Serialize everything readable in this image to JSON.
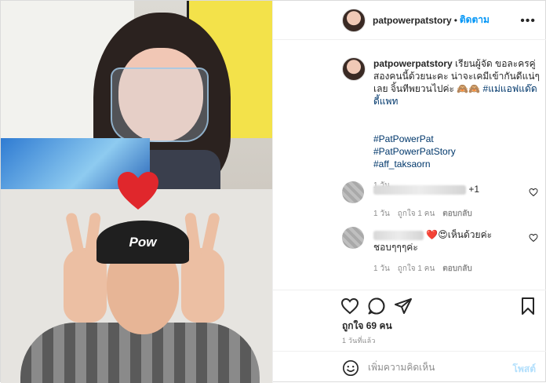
{
  "header": {
    "username": "patpowerpatstory",
    "separator": "•",
    "follow_label": "ติดตาม",
    "more_icon": "more-horizontal-icon"
  },
  "caption": {
    "username": "patpowerpatstory",
    "text": "เรียนผู้จัด ขอละครคู่สองคนนี้ด้วยนะคะ น่าจะเคมีเข้ากันดีแน่ๆเลย จิ้นทีพยวนไปค่ะ 🙈🙈",
    "inline_tag": "#แม่แอฟแด๊ดดี้แพท",
    "hashtags": [
      "#PatPowerPat",
      "#PatPowerPatStory",
      "#aff_taksaorn"
    ],
    "time": "1 วัน"
  },
  "comments": [
    {
      "suffix": "+1",
      "time": "1 วัน",
      "likes": "ถูกใจ 1 คน",
      "reply": "ตอบกลับ"
    },
    {
      "emoji": "❤️😍",
      "text": "เห็นด้วยค่ะ ชอบๆๆๆค่ะ",
      "time": "1 วัน",
      "likes": "ถูกใจ 1 คน",
      "reply": "ตอบกลับ"
    }
  ],
  "actions": {
    "icons": [
      "heart-icon",
      "comment-icon",
      "share-icon",
      "bookmark-icon"
    ],
    "likes": "ถูกใจ 69 คน",
    "time": "1 วันที่แล้ว"
  },
  "add_comment": {
    "placeholder": "เพิ่มความคิดเห็น",
    "post_label": "โพสต์"
  },
  "media": {
    "cap_text": "Pow",
    "colors": {
      "heart": "#e0272c",
      "accent": "#0095f6"
    }
  }
}
